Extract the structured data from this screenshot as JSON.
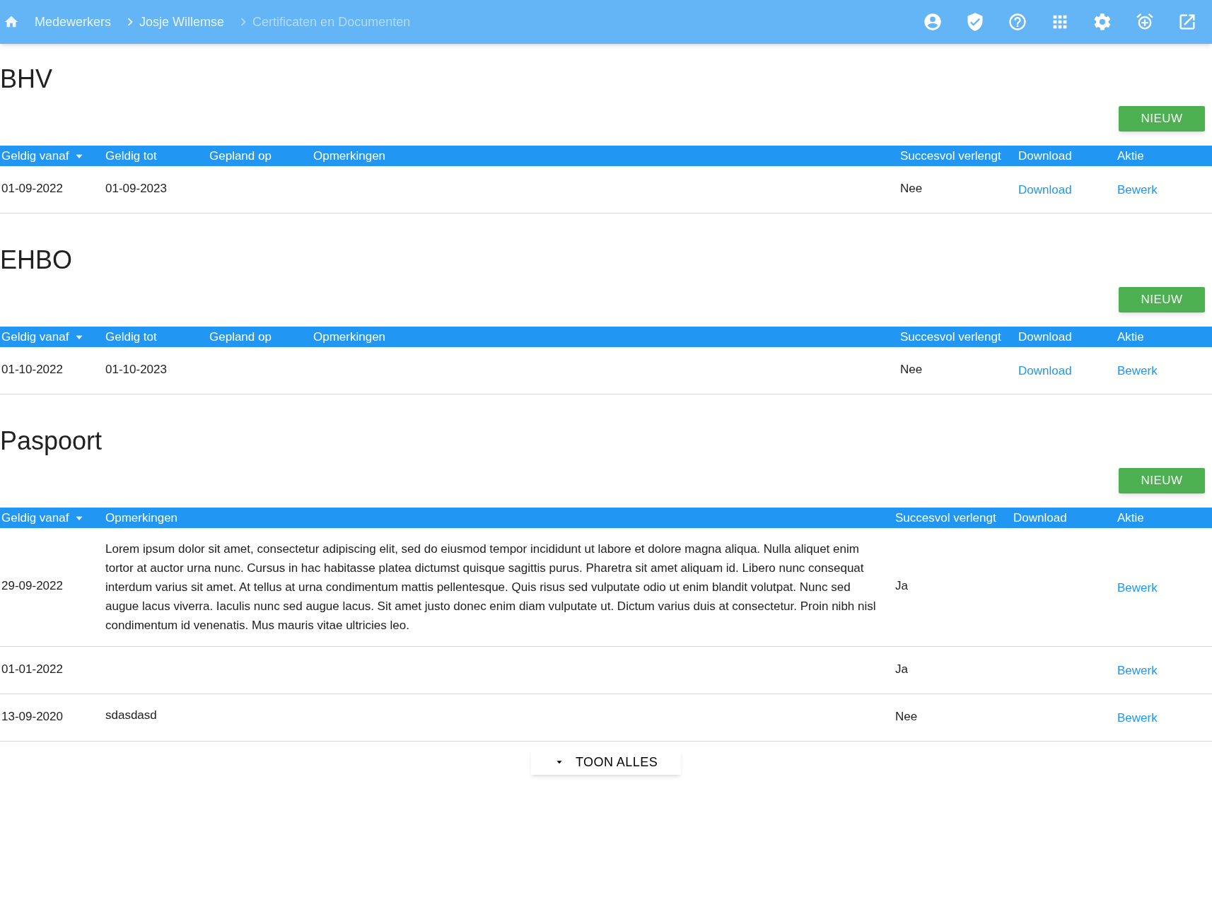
{
  "breadcrumbs": [
    {
      "label": "Medewerkers",
      "current": false
    },
    {
      "label": "Josje Willemse",
      "current": false
    },
    {
      "label": "Certificaten en Documenten",
      "current": true
    }
  ],
  "toolbar": [
    {
      "kind": "account"
    },
    {
      "kind": "shield"
    },
    {
      "kind": "help"
    },
    {
      "kind": "apps"
    },
    {
      "kind": "settings"
    },
    {
      "kind": "alarm"
    },
    {
      "kind": "external"
    }
  ],
  "sections": [
    {
      "title": "BHV",
      "new_button": "NIEUW",
      "columns": [
        {
          "label": "Geldig vanaf",
          "sorted": true
        },
        {
          "label": "Geldig tot",
          "sorted": false
        },
        {
          "label": "Gepland op",
          "sorted": false
        },
        {
          "label": "Opmerkingen",
          "sorted": false
        },
        {
          "label": "Succesvol verlengt",
          "sorted": false
        },
        {
          "label": "Download",
          "sorted": false
        },
        {
          "label": "Aktie",
          "sorted": false
        }
      ],
      "rows": [
        {
          "geldig_vanaf": "01-09-2022",
          "geldig_tot": "01-09-2023",
          "succesvol_verlengt": "Nee",
          "download": "Download",
          "aktie": "Bewerk"
        }
      ]
    },
    {
      "title": "EHBO",
      "new_button": "NIEUW",
      "columns": [
        {
          "label": "Geldig vanaf",
          "sorted": true
        },
        {
          "label": "Geldig tot",
          "sorted": false
        },
        {
          "label": "Gepland op",
          "sorted": false
        },
        {
          "label": "Opmerkingen",
          "sorted": false
        },
        {
          "label": "Succesvol verlengt",
          "sorted": false
        },
        {
          "label": "Download",
          "sorted": false
        },
        {
          "label": "Aktie",
          "sorted": false
        }
      ],
      "rows": [
        {
          "geldig_vanaf": "01-10-2022",
          "geldig_tot": "01-10-2023",
          "succesvol_verlengt": "Nee",
          "download": "Download",
          "aktie": "Bewerk"
        }
      ]
    },
    {
      "title": "Paspoort",
      "new_button": "NIEUW",
      "columns": [
        {
          "label": "Geldig vanaf",
          "sorted": true
        },
        {
          "label": "Opmerkingen",
          "sorted": false
        },
        {
          "label": "Succesvol verlengt",
          "sorted": false
        },
        {
          "label": "Download",
          "sorted": false
        },
        {
          "label": "Aktie",
          "sorted": false
        }
      ],
      "rows": [
        {
          "geldig_vanaf": "29-09-2022",
          "opmerkingen": "Lorem ipsum dolor sit amet, consectetur adipiscing elit, sed do eiusmod tempor incididunt ut labore et dolore magna aliqua. Nulla aliquet enim tortor at auctor urna nunc. Cursus in hac habitasse platea dictumst quisque sagittis purus. Pharetra sit amet aliquam id. Libero nunc consequat interdum varius sit amet. At tellus at urna condimentum mattis pellentesque. Quis risus sed vulputate odio ut enim blandit volutpat. Nunc sed augue lacus viverra. Iaculis nunc sed augue lacus. Sit amet justo donec enim diam vulputate ut. Dictum varius duis at consectetur. Proin nibh nisl condimentum id venenatis. Mus mauris vitae ultricies leo.",
          "succesvol_verlengt": "Ja",
          "aktie": "Bewerk"
        },
        {
          "geldig_vanaf": "01-01-2022",
          "succesvol_verlengt": "Ja",
          "aktie": "Bewerk"
        },
        {
          "geldig_vanaf": "13-09-2020",
          "opmerkingen": "sdasdasd",
          "succesvol_verlengt": "Nee",
          "aktie": "Bewerk"
        }
      ],
      "show_all": "TOON ALLES"
    }
  ]
}
